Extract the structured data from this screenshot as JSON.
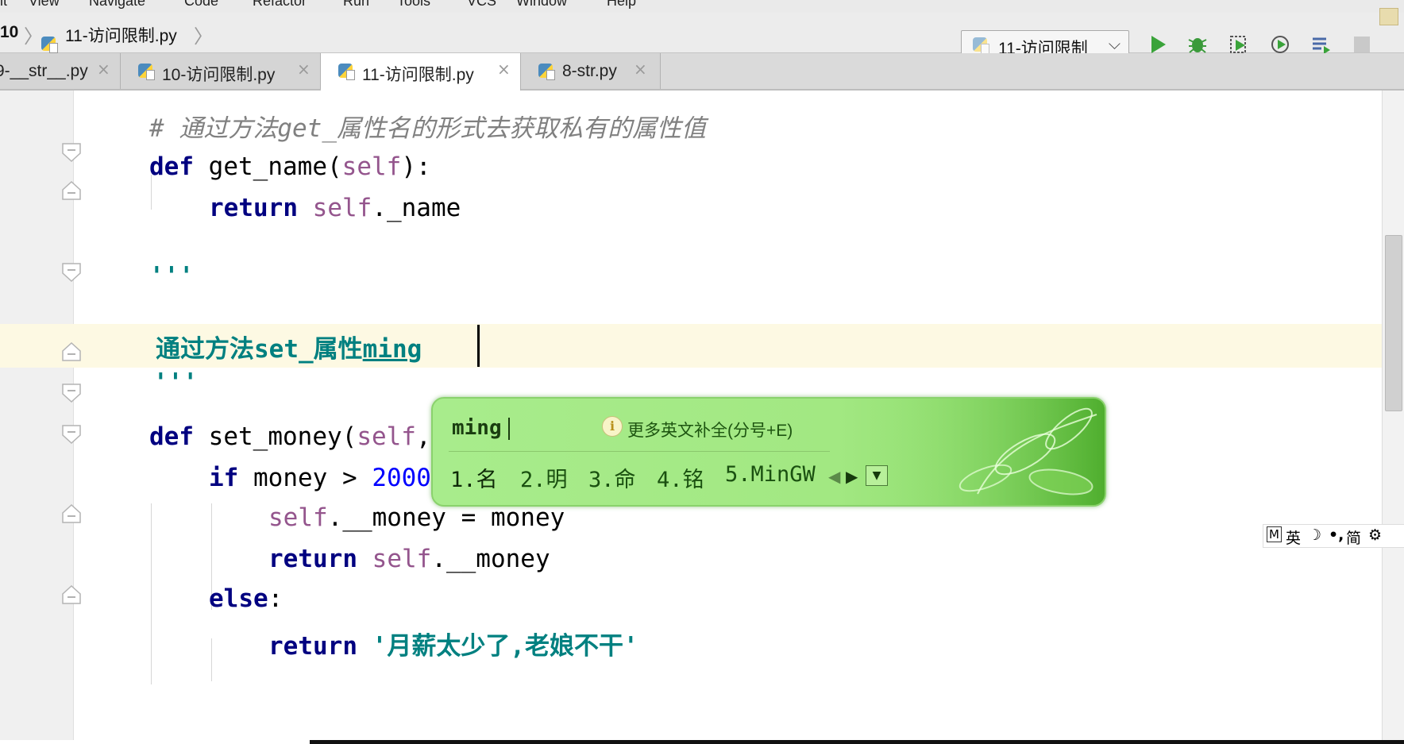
{
  "menubar": {
    "items": [
      "it",
      "View",
      "Navigate",
      "Code",
      "Refactor",
      "Run",
      "Tools",
      "VCS",
      "Window",
      "Help"
    ]
  },
  "breadcrumb": {
    "project": "10",
    "file": "11-访问限制.py"
  },
  "run_config": {
    "name": "11-访问限制"
  },
  "toolbar": {
    "run_icon": "play-icon",
    "debug_icon": "bug-icon",
    "coverage_icon": "coverage-icon",
    "profile_icon": "profile-icon",
    "concurrency_icon": "concurrency-icon",
    "stop_icon": "stop-icon"
  },
  "tabs": [
    {
      "label": "9-__str__.py",
      "active": false
    },
    {
      "label": "10-访问限制.py",
      "active": false
    },
    {
      "label": "11-访问限制.py",
      "active": true
    },
    {
      "label": "8-str.py",
      "active": false
    }
  ],
  "code": {
    "comment": "# 通过方法get_属性名的形式去获取私有的属性值",
    "def_kw": "def",
    "get_name_sig": "get_name(",
    "self": "self",
    "close_colon": "):",
    "return_kw": "return",
    "self_name_tail": "._name",
    "triple_quote": "'''",
    "doc_text_a": "通过方法set_属性",
    "doc_text_b": "ming",
    "set_money_sig": "set_money(",
    "set_money_tail": ",",
    "if_kw": "if",
    "if_cond": "money > ",
    "if_num": "2000",
    "assign_tail": ".__money = money",
    "return_money_tail": ".__money",
    "else_kw": "else",
    "colon": ":",
    "return_str": "'月薪太少了,老娘不干'"
  },
  "ime": {
    "composition": "ming",
    "hint": "更多英文补全(分号+E)",
    "candidates": [
      "1.名",
      "2.明",
      "3.命",
      "4.铭",
      "5.MinGW"
    ]
  },
  "ime_status": {
    "mode": "M",
    "lang": "英",
    "moon": "☽",
    "punct": "•,",
    "charset": "简",
    "gear": "⚙"
  },
  "colors": {
    "keyword": "#000080",
    "self": "#94558d",
    "number": "#0000ff",
    "string": "#008080",
    "comment": "#808080",
    "ime_bg": "#a8ec8c"
  }
}
